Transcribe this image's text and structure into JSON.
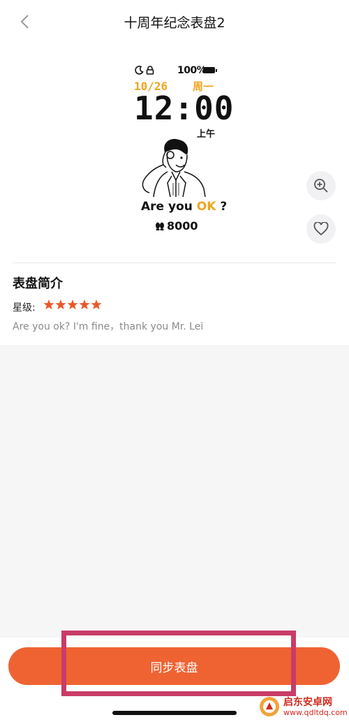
{
  "header": {
    "title": "十周年纪念表盘2"
  },
  "watch_face": {
    "battery": "100%",
    "date": "10/26",
    "weekday": "周一",
    "time": "12:00",
    "ampm": "上午",
    "caption_prefix": "Are you ",
    "caption_highlight": "OK",
    "caption_suffix": " ?",
    "steps": "8000",
    "accent_color": "#f0a51d"
  },
  "side_actions": {
    "zoom_icon": "zoom-in-icon",
    "favorite_icon": "heart-icon"
  },
  "intro": {
    "title": "表盘简介",
    "rating_label": "星级:",
    "rating": 5,
    "rating_max": 5,
    "description": "Are you ok?  I'm fine，thank you Mr. Lei"
  },
  "actions": {
    "sync_label": "同步表盘",
    "button_color": "#ef6333"
  },
  "watermark": {
    "name": "启东安卓网",
    "url": "www.qdltdq.com"
  }
}
